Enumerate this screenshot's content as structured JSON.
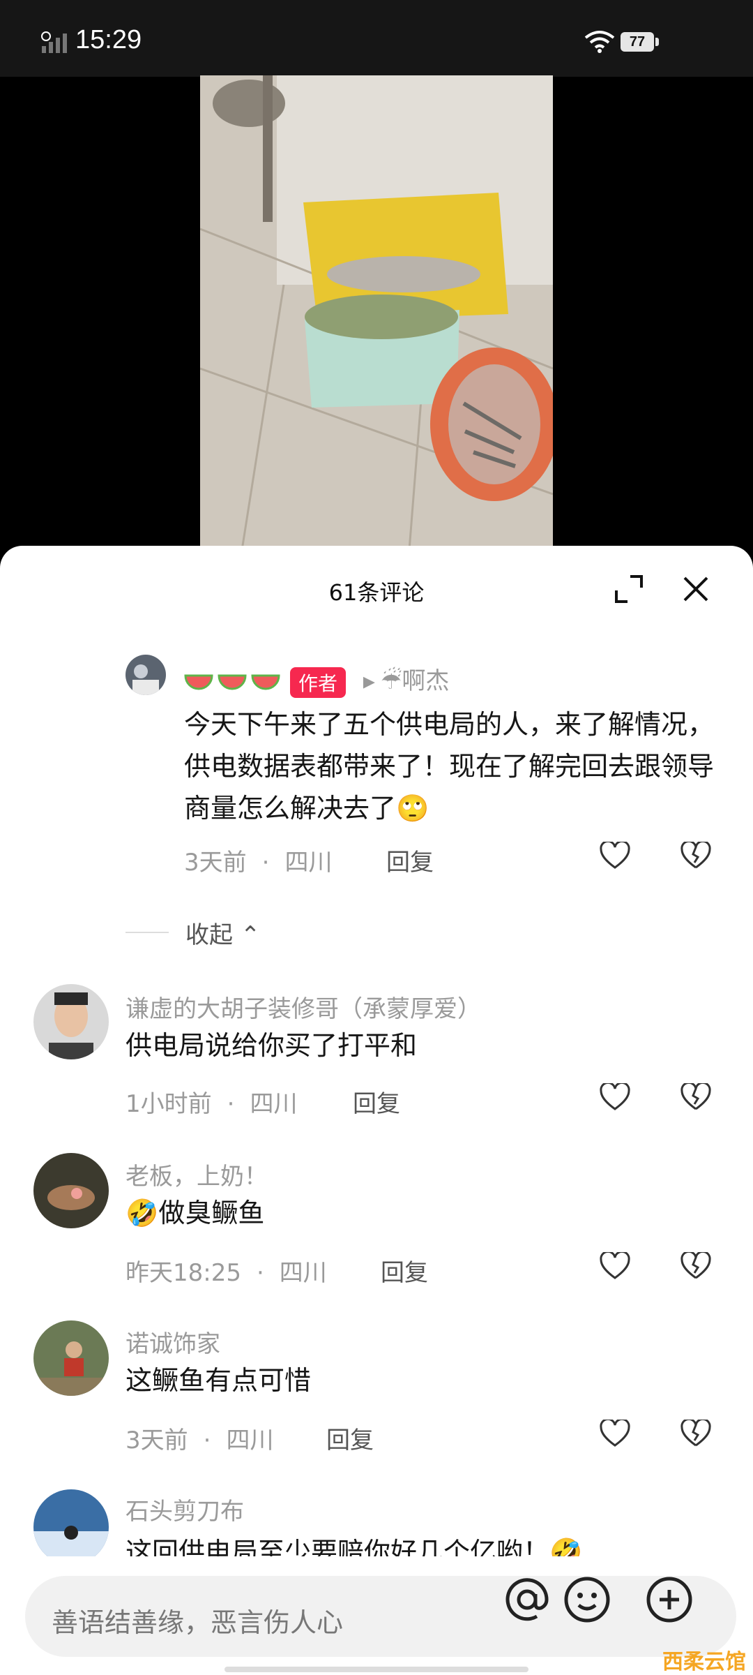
{
  "status_bar": {
    "time": "15:29",
    "battery": "77"
  },
  "panel": {
    "title": "61条评论"
  },
  "author_comment": {
    "user": "🍉🍉🍉",
    "badge": "作者",
    "reply_to": "☔啊杰",
    "text": "今天下午来了五个供电局的人，来了解情况，供电数据表都带来了！现在了解完回去跟领导商量怎么解决去了🙄",
    "time": "3天前",
    "location": "四川",
    "reply_label": "回复"
  },
  "collapse_label": "收起",
  "comments": [
    {
      "user": "谦虚的大胡子装修哥（承蒙厚爱）",
      "text": "供电局说给你买了打平和",
      "time": "1小时前",
      "location": "四川",
      "reply_label": "回复"
    },
    {
      "user": "老板，上奶！",
      "text": "🤣做臭鳜鱼",
      "time": "昨天18:25",
      "location": "四川",
      "reply_label": "回复"
    },
    {
      "user": "诺诚饰家",
      "text": "这鳜鱼有点可惜",
      "time": "3天前",
      "location": "四川",
      "reply_label": "回复"
    },
    {
      "user": "石头剪刀布",
      "text": "这回供电局至少要赔你好几个亿哟！🤣"
    }
  ],
  "input": {
    "placeholder": "善语结善缘，恶言伤人心"
  },
  "watermark": "西柔云馆",
  "icons": {
    "expand": "expand-icon",
    "close": "close-icon",
    "like": "heart-icon",
    "dislike": "broken-heart-icon",
    "at": "at-icon",
    "emoji": "smile-icon",
    "add": "plus-circle-icon"
  },
  "colors": {
    "author_badge": "#f6284f",
    "sheet_bg": "#ffffff",
    "muted_text": "#9a9a9a"
  }
}
